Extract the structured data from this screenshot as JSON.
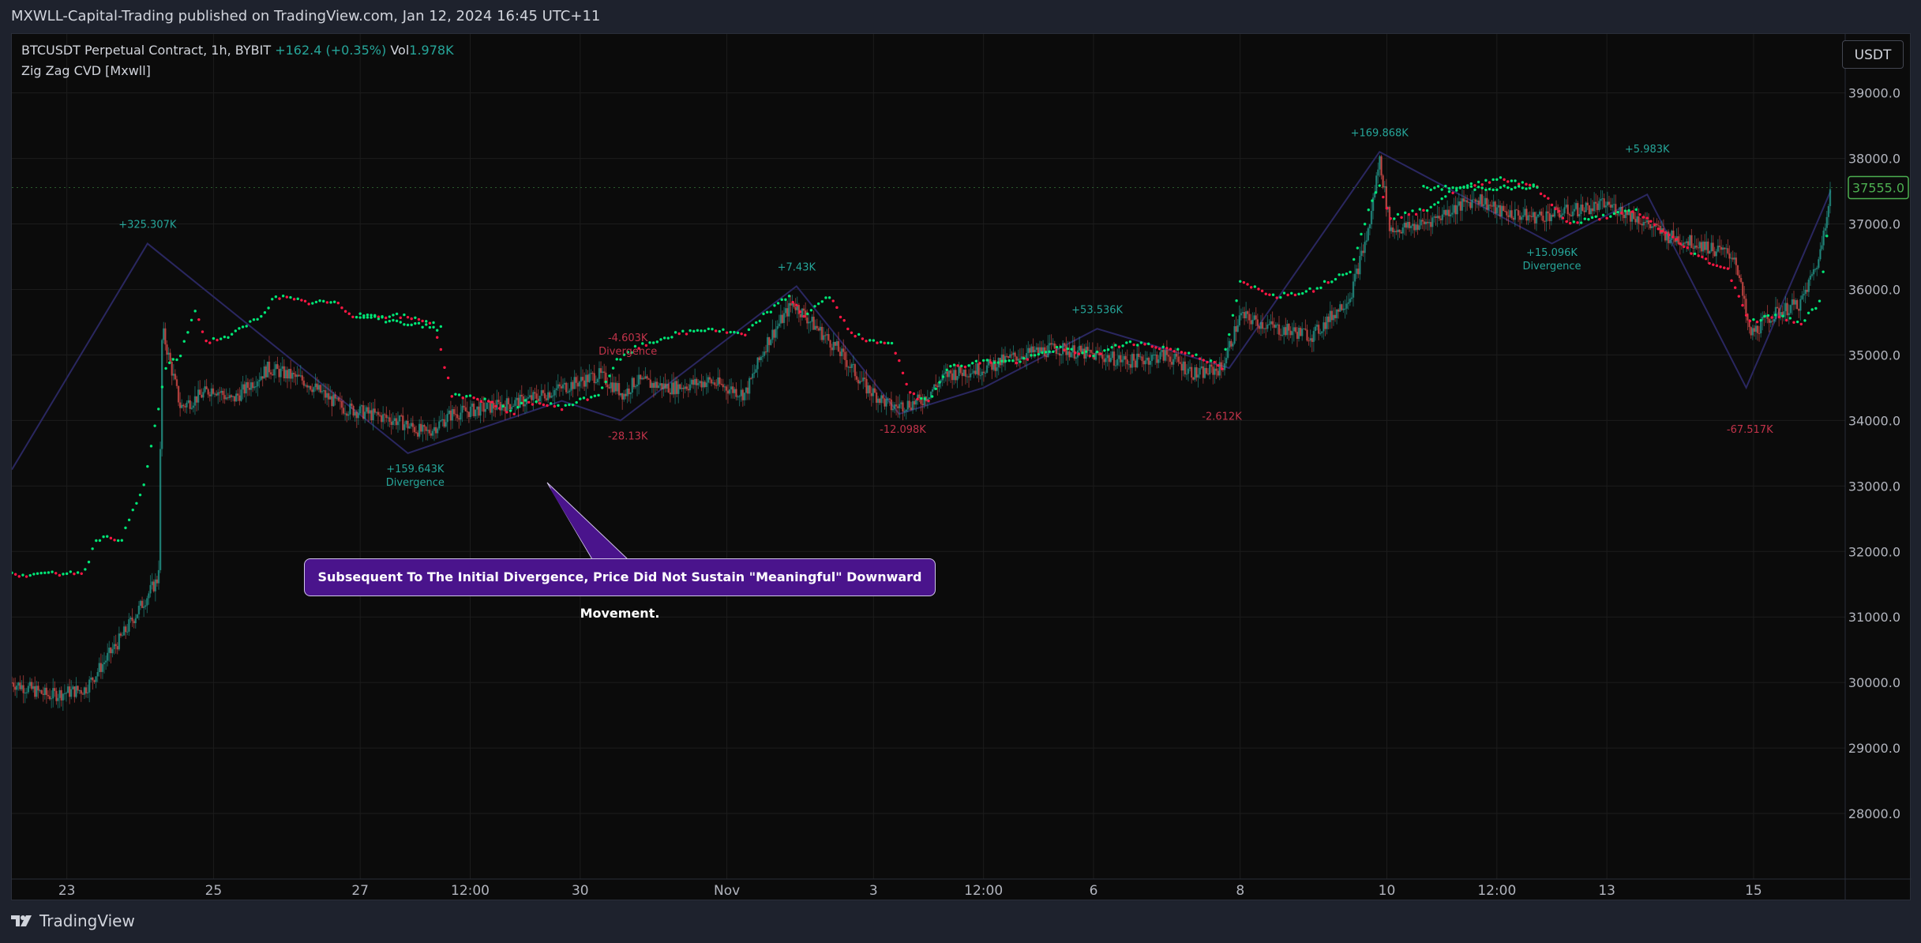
{
  "header": {
    "published_text": "MXWLL-Capital-Trading published on TradingView.com, Jan 12, 2024 16:45 UTC+11"
  },
  "legend": {
    "symbol_text": "BTCUSDT Perpetual Contract, 1h, BYBIT",
    "change_text": "+162.4 (+0.35%)",
    "vol_label": "Vol",
    "vol_value": "1.978K",
    "indicator_name": "Zig Zag CVD [Mxwll]"
  },
  "currency_button": "USDT",
  "callout_text": "Subsequent To The Initial Divergence, Price Did Not Sustain \"Meaningful\" Downward Movement.",
  "footer": {
    "brand": "TradingView"
  },
  "colors": {
    "background": "#0b0b0b",
    "up": "#26a69a",
    "down": "#ef5350",
    "cvd_up": "#00e676",
    "cvd_down": "#ff1744",
    "zigzag": "#2a2760",
    "last_price": "#4caf50",
    "callout": "#4a148c"
  },
  "chart_data": {
    "type": "candlestick",
    "symbol": "BTCUSDT",
    "timeframe": "1h",
    "y_axis_ticks": [
      28000,
      29000,
      30000,
      31000,
      32000,
      33000,
      34000,
      35000,
      36000,
      37000,
      38000,
      39000
    ],
    "y_axis_tick_labels": [
      "28000.0",
      "29000.0",
      "30000.0",
      "31000.0",
      "32000.0",
      "33000.0",
      "34000.0",
      "35000.0",
      "36000.0",
      "37000.0",
      "38000.0",
      "39000.0"
    ],
    "ylim": [
      27000,
      39900
    ],
    "x_ticks": [
      {
        "label": "23",
        "t": 1.5
      },
      {
        "label": "25",
        "t": 5.5
      },
      {
        "label": "27",
        "t": 9.5
      },
      {
        "label": "12:00",
        "t": 12.5
      },
      {
        "label": "30",
        "t": 15.5
      },
      {
        "label": "Nov",
        "t": 19.5
      },
      {
        "label": "3",
        "t": 23.5
      },
      {
        "label": "12:00",
        "t": 26.5
      },
      {
        "label": "6",
        "t": 29.5
      },
      {
        "label": "8",
        "t": 33.5
      },
      {
        "label": "10",
        "t": 37.5
      },
      {
        "label": "12:00",
        "t": 40.5
      },
      {
        "label": "13",
        "t": 43.5
      },
      {
        "label": "15",
        "t": 47.5
      }
    ],
    "xlim": [
      0,
      50
    ],
    "last_price": 37555.0,
    "last_price_label": "37555.0",
    "price_path": [
      [
        0,
        30000
      ],
      [
        1,
        29800
      ],
      [
        2,
        29900
      ],
      [
        3,
        30700
      ],
      [
        4,
        31600
      ],
      [
        4.1,
        35400
      ],
      [
        4.6,
        34200
      ],
      [
        5.5,
        34500
      ],
      [
        6,
        34300
      ],
      [
        7,
        34800
      ],
      [
        8,
        34600
      ],
      [
        9,
        34200
      ],
      [
        10.5,
        34000
      ],
      [
        11.3,
        33800
      ],
      [
        12,
        34100
      ],
      [
        13,
        34200
      ],
      [
        14,
        34300
      ],
      [
        15,
        34500
      ],
      [
        16,
        34700
      ],
      [
        16.7,
        34400
      ],
      [
        17,
        34600
      ],
      [
        18,
        34500
      ],
      [
        19,
        34600
      ],
      [
        20,
        34400
      ],
      [
        20.6,
        35200
      ],
      [
        21.3,
        35800
      ],
      [
        21.8,
        35500
      ],
      [
        22.5,
        35100
      ],
      [
        23.3,
        34500
      ],
      [
        24,
        34200
      ],
      [
        24.8,
        34300
      ],
      [
        25.5,
        34700
      ],
      [
        26.5,
        34800
      ],
      [
        27.5,
        35000
      ],
      [
        28.5,
        35100
      ],
      [
        29.5,
        35000
      ],
      [
        30.5,
        34900
      ],
      [
        31.5,
        35000
      ],
      [
        32.3,
        34700
      ],
      [
        33,
        34800
      ],
      [
        33.5,
        35600
      ],
      [
        34.5,
        35400
      ],
      [
        35.5,
        35300
      ],
      [
        36.5,
        35900
      ],
      [
        37,
        36900
      ],
      [
        37.3,
        38000
      ],
      [
        37.6,
        36900
      ],
      [
        38.5,
        37000
      ],
      [
        39.2,
        37200
      ],
      [
        40,
        37400
      ],
      [
        40.5,
        37200
      ],
      [
        41.5,
        37100
      ],
      [
        42.5,
        37200
      ],
      [
        43.5,
        37300
      ],
      [
        44.3,
        37100
      ],
      [
        45.2,
        36800
      ],
      [
        46,
        36700
      ],
      [
        47,
        36500
      ],
      [
        47.4,
        35300
      ],
      [
        48,
        35600
      ],
      [
        48.8,
        35800
      ],
      [
        49.3,
        36500
      ],
      [
        49.6,
        37555
      ]
    ],
    "cvd_path": [
      [
        0,
        31650
      ],
      [
        1,
        31650
      ],
      [
        2,
        31700
      ],
      [
        2.3,
        32200
      ],
      [
        3,
        32200
      ],
      [
        3.6,
        33000
      ],
      [
        4.2,
        34800
      ],
      [
        4.6,
        35000
      ],
      [
        5,
        35700
      ],
      [
        5.3,
        35200
      ],
      [
        6,
        35300
      ],
      [
        6.8,
        35600
      ],
      [
        7.2,
        35900
      ],
      [
        8,
        35800
      ],
      [
        8.8,
        35800
      ],
      [
        9.3,
        35600
      ],
      [
        10.5,
        35600
      ],
      [
        11.5,
        35500
      ],
      [
        12,
        34400
      ],
      [
        13,
        34300
      ],
      [
        13.7,
        34100
      ],
      [
        14,
        34300
      ],
      [
        15,
        34200
      ],
      [
        16,
        34400
      ],
      [
        16.5,
        34900
      ],
      [
        17,
        35100
      ],
      [
        18,
        35300
      ],
      [
        19,
        35400
      ],
      [
        20,
        35300
      ],
      [
        20.5,
        35600
      ],
      [
        21.2,
        35900
      ],
      [
        21.6,
        35600
      ],
      [
        22.3,
        35900
      ],
      [
        22.8,
        35400
      ],
      [
        23.3,
        35200
      ],
      [
        24,
        35200
      ],
      [
        24.5,
        34400
      ],
      [
        25,
        34300
      ],
      [
        25.5,
        34800
      ],
      [
        26.5,
        34900
      ],
      [
        27.5,
        34900
      ],
      [
        28.5,
        35100
      ],
      [
        29.5,
        35000
      ],
      [
        30.5,
        35200
      ],
      [
        31.5,
        35100
      ],
      [
        32.3,
        35000
      ],
      [
        33,
        34800
      ],
      [
        33.5,
        36100
      ],
      [
        34.5,
        35900
      ],
      [
        35.5,
        36000
      ],
      [
        36.5,
        36300
      ],
      [
        37,
        37200
      ],
      [
        37.3,
        37600
      ],
      [
        37.6,
        37100
      ],
      [
        38.5,
        37200
      ],
      [
        39.3,
        37500
      ],
      [
        40.5,
        37700
      ],
      [
        41.5,
        37600
      ],
      [
        42.5,
        37000
      ],
      [
        43.3,
        37100
      ],
      [
        44.3,
        37200
      ],
      [
        45,
        36900
      ],
      [
        46,
        36500
      ],
      [
        46.8,
        36300
      ],
      [
        47.4,
        35500
      ],
      [
        48,
        35600
      ],
      [
        48.8,
        35500
      ],
      [
        49.3,
        35800
      ],
      [
        49.6,
        37300
      ]
    ],
    "cvd_tails": [
      {
        "from": [
          9.5,
          35600
        ],
        "to": [
          11.7,
          35400
        ]
      },
      {
        "from": [
          38.5,
          37550
        ],
        "to": [
          41.7,
          37550
        ]
      }
    ],
    "zigzag": [
      [
        0,
        33250
      ],
      [
        3.7,
        36700
      ],
      [
        10.8,
        33500
      ],
      [
        15,
        34300
      ],
      [
        16.6,
        34000
      ],
      [
        21.4,
        36050
      ],
      [
        24.2,
        34100
      ],
      [
        26.5,
        34500
      ],
      [
        29.6,
        35400
      ],
      [
        33.2,
        34800
      ],
      [
        37.3,
        38100
      ],
      [
        42,
        36700
      ],
      [
        44.6,
        37450
      ],
      [
        47.3,
        34500
      ],
      [
        49.6,
        37500
      ]
    ],
    "annotations": [
      {
        "t": 3.7,
        "y": 36700,
        "text": "+325.307K",
        "color": "up",
        "pos": "above"
      },
      {
        "t": 11,
        "y": 33500,
        "text": "+159.643K",
        "sub": "Divergence",
        "color": "up",
        "pos": "below"
      },
      {
        "t": 16.8,
        "y": 34000,
        "text": "-28.13K",
        "color": "down",
        "pos": "below"
      },
      {
        "t": 16.8,
        "y": 34800,
        "text": "-4.603K",
        "sub": "Divergence",
        "color": "down",
        "pos": "above"
      },
      {
        "t": 21.4,
        "y": 36050,
        "text": "+7.43K",
        "color": "up",
        "pos": "above"
      },
      {
        "t": 24.3,
        "y": 34100,
        "text": "-12.098K",
        "color": "down",
        "pos": "below"
      },
      {
        "t": 29.6,
        "y": 35400,
        "text": "+53.536K",
        "color": "up",
        "pos": "above"
      },
      {
        "t": 33,
        "y": 34300,
        "text": "-2.612K",
        "color": "down",
        "pos": "below"
      },
      {
        "t": 37.3,
        "y": 38100,
        "text": "+169.868K",
        "color": "up",
        "pos": "above"
      },
      {
        "t": 42,
        "y": 36800,
        "text": "+15.096K",
        "sub": "Divergence",
        "color": "up",
        "pos": "below"
      },
      {
        "t": 44.6,
        "y": 37850,
        "text": "+5.983K",
        "color": "up",
        "pos": "above"
      },
      {
        "t": 47.4,
        "y": 34100,
        "text": "-67.517K",
        "color": "down",
        "pos": "below"
      }
    ]
  }
}
